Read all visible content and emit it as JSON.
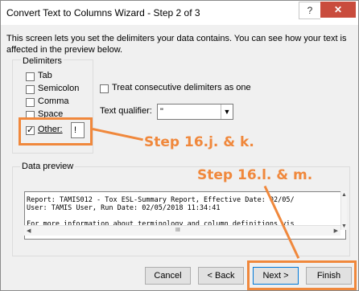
{
  "window": {
    "title": "Convert Text to Columns Wizard - Step 2 of 3",
    "help_label": "?",
    "close_label": "✕"
  },
  "description": "This screen lets you set the delimiters your data contains.  You can see how your text is affected in the preview below.",
  "delimiters": {
    "group_label": "Delimiters",
    "items": [
      {
        "label": "Tab",
        "checked": false
      },
      {
        "label": "Semicolon",
        "checked": false
      },
      {
        "label": "Comma",
        "checked": false
      },
      {
        "label": "Space",
        "checked": false
      },
      {
        "label": "Other:",
        "checked": true
      }
    ],
    "other_value": "!"
  },
  "options": {
    "consecutive_label": "Treat consecutive delimiters as one",
    "consecutive_checked": false,
    "qualifier_label": "Text qualifier:",
    "qualifier_value": "\""
  },
  "annotations": {
    "step_a": "Step 16.j. & k.",
    "step_b": "Step 16.l. & m.",
    "color": "#f0883c"
  },
  "preview": {
    "label": "Data preview",
    "lines": [
      "Report: TAMIS012 - Tox ESL-Summary Report, Effective Date: 02/05/",
      "User: TAMIS User, Run Date: 02/05/2018 11:34:41",
      "",
      "For more information about terminology and column definitions vis"
    ],
    "scroll_mid": "III"
  },
  "buttons": {
    "cancel": "Cancel",
    "back": "< Back",
    "next": "Next >",
    "finish": "Finish"
  }
}
